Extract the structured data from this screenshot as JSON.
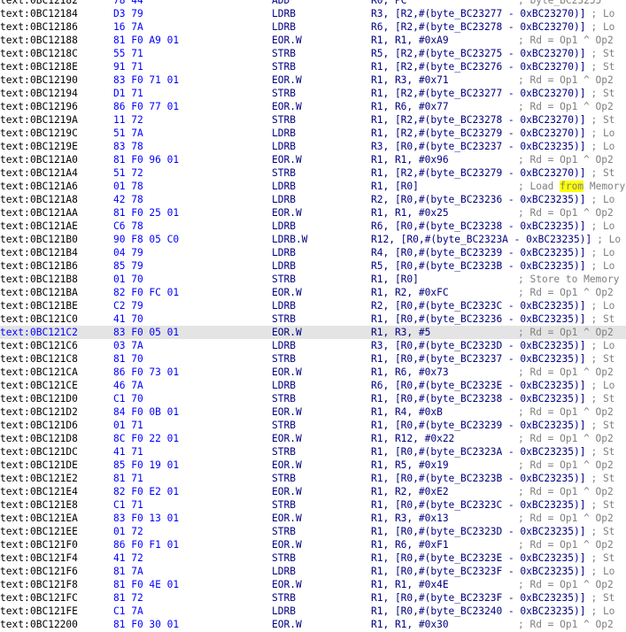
{
  "listing": {
    "rows": [
      {
        "seg": "text:",
        "addr": "0BC12182",
        "bytes": "78 44",
        "mn": "ADD",
        "op": "R0, PC",
        "cm": "; byte_BC23255"
      },
      {
        "seg": "text:",
        "addr": "0BC12184",
        "bytes": "D3 79",
        "mn": "LDRB",
        "op": "R3, [R2,#(byte_BC23277 - 0xBC23270)]",
        "cm": "; Lo"
      },
      {
        "seg": "text:",
        "addr": "0BC12186",
        "bytes": "16 7A",
        "mn": "LDRB",
        "op": "R6, [R2,#(byte_BC23278 - 0xBC23270)]",
        "cm": "; Lo"
      },
      {
        "seg": "text:",
        "addr": "0BC12188",
        "bytes": "81 F0 A9 01",
        "mn": "EOR.W",
        "op": "R1, R1, #0xA9",
        "cm": "; Rd = Op1 ^ Op2"
      },
      {
        "seg": "text:",
        "addr": "0BC1218C",
        "bytes": "55 71",
        "mn": "STRB",
        "op": "R5, [R2,#(byte_BC23275 - 0xBC23270)]",
        "cm": "; St"
      },
      {
        "seg": "text:",
        "addr": "0BC1218E",
        "bytes": "91 71",
        "mn": "STRB",
        "op": "R1, [R2,#(byte_BC23276 - 0xBC23270)]",
        "cm": "; St"
      },
      {
        "seg": "text:",
        "addr": "0BC12190",
        "bytes": "83 F0 71 01",
        "mn": "EOR.W",
        "op": "R1, R3, #0x71",
        "cm": "; Rd = Op1 ^ Op2"
      },
      {
        "seg": "text:",
        "addr": "0BC12194",
        "bytes": "D1 71",
        "mn": "STRB",
        "op": "R1, [R2,#(byte_BC23277 - 0xBC23270)]",
        "cm": "; St"
      },
      {
        "seg": "text:",
        "addr": "0BC12196",
        "bytes": "86 F0 77 01",
        "mn": "EOR.W",
        "op": "R1, R6, #0x77",
        "cm": "; Rd = Op1 ^ Op2"
      },
      {
        "seg": "text:",
        "addr": "0BC1219A",
        "bytes": "11 72",
        "mn": "STRB",
        "op": "R1, [R2,#(byte_BC23278 - 0xBC23270)]",
        "cm": "; St"
      },
      {
        "seg": "text:",
        "addr": "0BC1219C",
        "bytes": "51 7A",
        "mn": "LDRB",
        "op": "R1, [R2,#(byte_BC23279 - 0xBC23270)]",
        "cm": "; Lo"
      },
      {
        "seg": "text:",
        "addr": "0BC1219E",
        "bytes": "83 78",
        "mn": "LDRB",
        "op": "R3, [R0,#(byte_BC23237 - 0xBC23235)]",
        "cm": "; Lo"
      },
      {
        "seg": "text:",
        "addr": "0BC121A0",
        "bytes": "81 F0 96 01",
        "mn": "EOR.W",
        "op": "R1, R1, #0x96",
        "cm": "; Rd = Op1 ^ Op2"
      },
      {
        "seg": "text:",
        "addr": "0BC121A4",
        "bytes": "51 72",
        "mn": "STRB",
        "op": "R1, [R2,#(byte_BC23279 - 0xBC23270)]",
        "cm": "; St"
      },
      {
        "seg": "text:",
        "addr": "0BC121A6",
        "bytes": "01 78",
        "mn": "LDRB",
        "op": "R1, [R0]",
        "cm": "; Load from Memory",
        "cm_pre": "; Load ",
        "cm_hl": "from",
        "cm_post": " Memory"
      },
      {
        "seg": "text:",
        "addr": "0BC121A8",
        "bytes": "42 78",
        "mn": "LDRB",
        "op": "R2, [R0,#(byte_BC23236 - 0xBC23235)]",
        "cm": "; Lo"
      },
      {
        "seg": "text:",
        "addr": "0BC121AA",
        "bytes": "81 F0 25 01",
        "mn": "EOR.W",
        "op": "R1, R1, #0x25",
        "cm": "; Rd = Op1 ^ Op2"
      },
      {
        "seg": "text:",
        "addr": "0BC121AE",
        "bytes": "C6 78",
        "mn": "LDRB",
        "op": "R6, [R0,#(byte_BC23238 - 0xBC23235)]",
        "cm": "; Lo"
      },
      {
        "seg": "text:",
        "addr": "0BC121B0",
        "bytes": "90 F8 05 C0",
        "mn": "LDRB.W",
        "op": "R12, [R0,#(byte_BC2323A - 0xBC23235)]",
        "cm": "; Lo"
      },
      {
        "seg": "text:",
        "addr": "0BC121B4",
        "bytes": "04 79",
        "mn": "LDRB",
        "op": "R4, [R0,#(byte_BC23239 - 0xBC23235)]",
        "cm": "; Lo"
      },
      {
        "seg": "text:",
        "addr": "0BC121B6",
        "bytes": "85 79",
        "mn": "LDRB",
        "op": "R5, [R0,#(byte_BC2323B - 0xBC23235)]",
        "cm": "; Lo"
      },
      {
        "seg": "text:",
        "addr": "0BC121B8",
        "bytes": "01 70",
        "mn": "STRB",
        "op": "R1, [R0]",
        "cm": "; Store to Memory"
      },
      {
        "seg": "text:",
        "addr": "0BC121BA",
        "bytes": "82 F0 FC 01",
        "mn": "EOR.W",
        "op": "R1, R2, #0xFC",
        "cm": "; Rd = Op1 ^ Op2"
      },
      {
        "seg": "text:",
        "addr": "0BC121BE",
        "bytes": "C2 79",
        "mn": "LDRB",
        "op": "R2, [R0,#(byte_BC2323C - 0xBC23235)]",
        "cm": "; Lo"
      },
      {
        "seg": "text:",
        "addr": "0BC121C0",
        "bytes": "41 70",
        "mn": "STRB",
        "op": "R1, [R0,#(byte_BC23236 - 0xBC23235)]",
        "cm": "; St"
      },
      {
        "seg": "text:",
        "addr": "0BC121C2",
        "bytes": "83 F0 05 01",
        "mn": "EOR.W",
        "op": "R1, R3, #5",
        "cm": "; Rd = Op1 ^ Op2",
        "selected": true
      },
      {
        "seg": "text:",
        "addr": "0BC121C6",
        "bytes": "03 7A",
        "mn": "LDRB",
        "op": "R3, [R0,#(byte_BC2323D - 0xBC23235)]",
        "cm": "; Lo"
      },
      {
        "seg": "text:",
        "addr": "0BC121C8",
        "bytes": "81 70",
        "mn": "STRB",
        "op": "R1, [R0,#(byte_BC23237 - 0xBC23235)]",
        "cm": "; St"
      },
      {
        "seg": "text:",
        "addr": "0BC121CA",
        "bytes": "86 F0 73 01",
        "mn": "EOR.W",
        "op": "R1, R6, #0x73",
        "cm": "; Rd = Op1 ^ Op2"
      },
      {
        "seg": "text:",
        "addr": "0BC121CE",
        "bytes": "46 7A",
        "mn": "LDRB",
        "op": "R6, [R0,#(byte_BC2323E - 0xBC23235)]",
        "cm": "; Lo"
      },
      {
        "seg": "text:",
        "addr": "0BC121D0",
        "bytes": "C1 70",
        "mn": "STRB",
        "op": "R1, [R0,#(byte_BC23238 - 0xBC23235)]",
        "cm": "; St"
      },
      {
        "seg": "text:",
        "addr": "0BC121D2",
        "bytes": "84 F0 0B 01",
        "mn": "EOR.W",
        "op": "R1, R4, #0xB",
        "cm": "; Rd = Op1 ^ Op2"
      },
      {
        "seg": "text:",
        "addr": "0BC121D6",
        "bytes": "01 71",
        "mn": "STRB",
        "op": "R1, [R0,#(byte_BC23239 - 0xBC23235)]",
        "cm": "; St"
      },
      {
        "seg": "text:",
        "addr": "0BC121D8",
        "bytes": "8C F0 22 01",
        "mn": "EOR.W",
        "op": "R1, R12, #0x22",
        "cm": "; Rd = Op1 ^ Op2"
      },
      {
        "seg": "text:",
        "addr": "0BC121DC",
        "bytes": "41 71",
        "mn": "STRB",
        "op": "R1, [R0,#(byte_BC2323A - 0xBC23235)]",
        "cm": "; St"
      },
      {
        "seg": "text:",
        "addr": "0BC121DE",
        "bytes": "85 F0 19 01",
        "mn": "EOR.W",
        "op": "R1, R5, #0x19",
        "cm": "; Rd = Op1 ^ Op2"
      },
      {
        "seg": "text:",
        "addr": "0BC121E2",
        "bytes": "81 71",
        "mn": "STRB",
        "op": "R1, [R0,#(byte_BC2323B - 0xBC23235)]",
        "cm": "; St"
      },
      {
        "seg": "text:",
        "addr": "0BC121E4",
        "bytes": "82 F0 E2 01",
        "mn": "EOR.W",
        "op": "R1, R2, #0xE2",
        "cm": "; Rd = Op1 ^ Op2"
      },
      {
        "seg": "text:",
        "addr": "0BC121E8",
        "bytes": "C1 71",
        "mn": "STRB",
        "op": "R1, [R0,#(byte_BC2323C - 0xBC23235)]",
        "cm": "; St"
      },
      {
        "seg": "text:",
        "addr": "0BC121EA",
        "bytes": "83 F0 13 01",
        "mn": "EOR.W",
        "op": "R1, R3, #0x13",
        "cm": "; Rd = Op1 ^ Op2"
      },
      {
        "seg": "text:",
        "addr": "0BC121EE",
        "bytes": "01 72",
        "mn": "STRB",
        "op": "R1, [R0,#(byte_BC2323D - 0xBC23235)]",
        "cm": "; St"
      },
      {
        "seg": "text:",
        "addr": "0BC121F0",
        "bytes": "86 F0 F1 01",
        "mn": "EOR.W",
        "op": "R1, R6, #0xF1",
        "cm": "; Rd = Op1 ^ Op2"
      },
      {
        "seg": "text:",
        "addr": "0BC121F4",
        "bytes": "41 72",
        "mn": "STRB",
        "op": "R1, [R0,#(byte_BC2323E - 0xBC23235)]",
        "cm": "; St"
      },
      {
        "seg": "text:",
        "addr": "0BC121F6",
        "bytes": "81 7A",
        "mn": "LDRB",
        "op": "R1, [R0,#(byte_BC2323F - 0xBC23235)]",
        "cm": "; Lo"
      },
      {
        "seg": "text:",
        "addr": "0BC121F8",
        "bytes": "81 F0 4E 01",
        "mn": "EOR.W",
        "op": "R1, R1, #0x4E",
        "cm": "; Rd = Op1 ^ Op2"
      },
      {
        "seg": "text:",
        "addr": "0BC121FC",
        "bytes": "81 72",
        "mn": "STRB",
        "op": "R1, [R0,#(byte_BC2323F - 0xBC23235)]",
        "cm": "; St"
      },
      {
        "seg": "text:",
        "addr": "0BC121FE",
        "bytes": "C1 7A",
        "mn": "LDRB",
        "op": "R1, [R0,#(byte_BC23240 - 0xBC23235)]",
        "cm": "; Lo"
      },
      {
        "seg": "text:",
        "addr": "0BC12200",
        "bytes": "81 F0 30 01",
        "mn": "EOR.W",
        "op": "R1, R1, #0x30",
        "cm": "; Rd = Op1 ^ Op2"
      }
    ]
  },
  "colors": {
    "background": "#ffffff",
    "address": "#000000",
    "bytes": "#0000ff",
    "instruction": "#000080",
    "comment": "#808080",
    "selected_line": "#e4e4e4",
    "search_highlight": "#ffff00"
  }
}
